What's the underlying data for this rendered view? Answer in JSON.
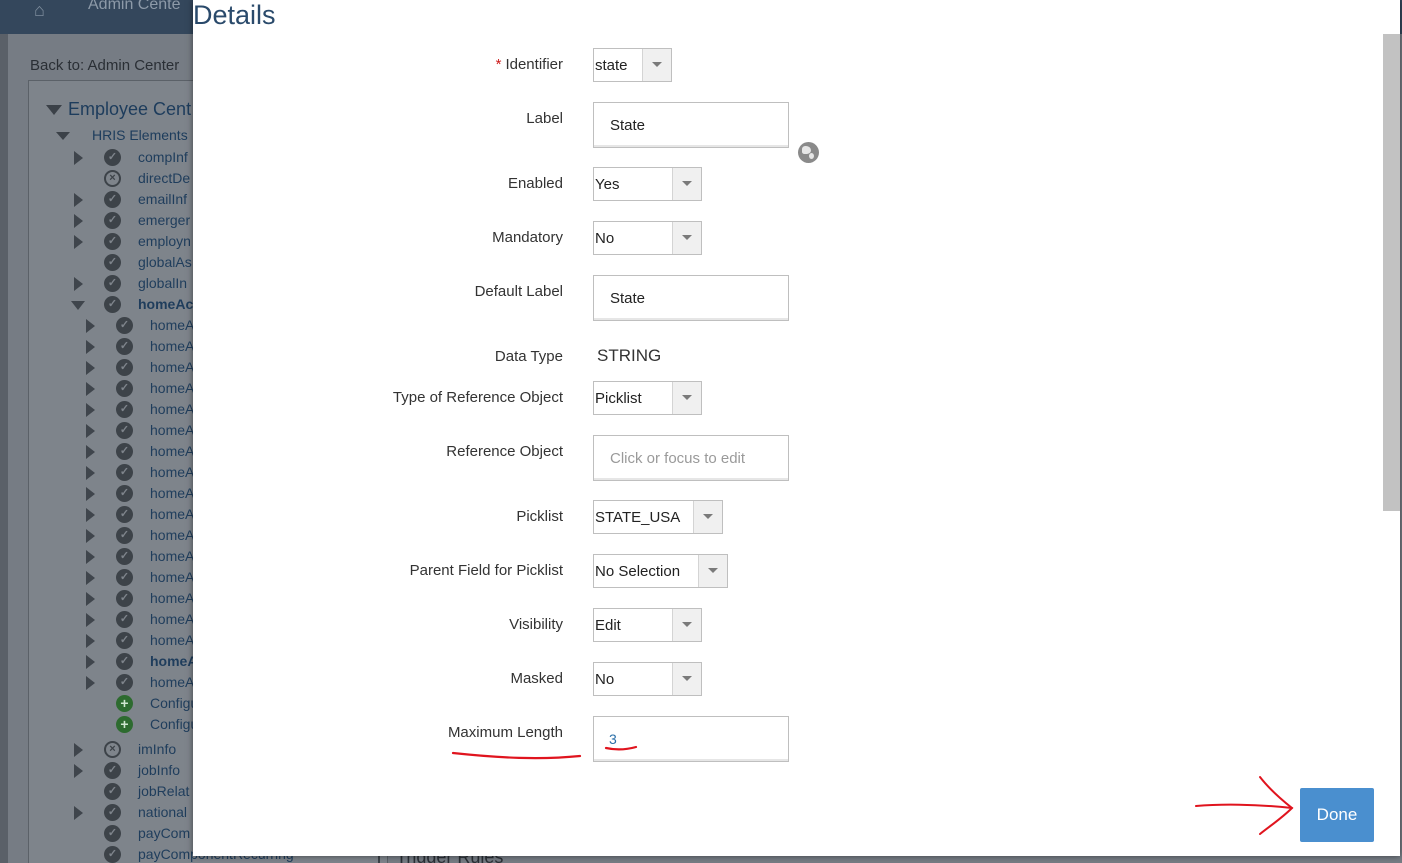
{
  "background": {
    "header_app": "Admin Cente",
    "back_link": "Back to: Admin Center",
    "tree_root": "Employee Cent",
    "tree_hris": "HRIS Elements",
    "tree_items": [
      {
        "label": "compInf",
        "icon": "ok",
        "arrow": "closed",
        "indent": 0
      },
      {
        "label": "directDe",
        "icon": "x",
        "arrow": "none",
        "indent": 0
      },
      {
        "label": "emailInf",
        "icon": "ok",
        "arrow": "closed",
        "indent": 0
      },
      {
        "label": "emerger",
        "icon": "ok",
        "arrow": "closed",
        "indent": 0
      },
      {
        "label": "employn",
        "icon": "ok",
        "arrow": "closed",
        "indent": 0
      },
      {
        "label": "globalAs",
        "icon": "ok",
        "arrow": "none",
        "indent": 0
      },
      {
        "label": "globalIn",
        "icon": "ok",
        "arrow": "closed",
        "indent": 0
      },
      {
        "label": "homeAc",
        "icon": "ok",
        "arrow": "open",
        "indent": 0,
        "bold": true
      },
      {
        "label": "homeAc",
        "icon": "ok",
        "arrow": "closed",
        "indent": 1
      },
      {
        "label": "homeAc",
        "icon": "ok",
        "arrow": "closed",
        "indent": 1
      },
      {
        "label": "homeAc",
        "icon": "ok",
        "arrow": "closed",
        "indent": 1
      },
      {
        "label": "homeAc",
        "icon": "ok",
        "arrow": "closed",
        "indent": 1
      },
      {
        "label": "homeAc",
        "icon": "ok",
        "arrow": "closed",
        "indent": 1
      },
      {
        "label": "homeAc",
        "icon": "ok",
        "arrow": "closed",
        "indent": 1
      },
      {
        "label": "homeAc",
        "icon": "ok",
        "arrow": "closed",
        "indent": 1
      },
      {
        "label": "homeAc",
        "icon": "ok",
        "arrow": "closed",
        "indent": 1
      },
      {
        "label": "homeAc",
        "icon": "ok",
        "arrow": "closed",
        "indent": 1
      },
      {
        "label": "homeAc",
        "icon": "ok",
        "arrow": "closed",
        "indent": 1
      },
      {
        "label": "homeAc",
        "icon": "ok",
        "arrow": "closed",
        "indent": 1
      },
      {
        "label": "homeAc",
        "icon": "ok",
        "arrow": "closed",
        "indent": 1
      },
      {
        "label": "homeAc",
        "icon": "ok",
        "arrow": "closed",
        "indent": 1
      },
      {
        "label": "homeAc",
        "icon": "ok",
        "arrow": "closed",
        "indent": 1
      },
      {
        "label": "homeAc",
        "icon": "ok",
        "arrow": "closed",
        "indent": 1
      },
      {
        "label": "homeAc",
        "icon": "ok",
        "arrow": "closed",
        "indent": 1
      },
      {
        "label": "homeA",
        "icon": "ok",
        "arrow": "closed",
        "indent": 1,
        "bold": true
      },
      {
        "label": "homeAc",
        "icon": "ok",
        "arrow": "closed",
        "indent": 1
      },
      {
        "label": "Configu",
        "icon": "plus",
        "arrow": "none",
        "indent": 1
      },
      {
        "label": "Configu",
        "icon": "plus",
        "arrow": "none",
        "indent": 1
      },
      {
        "label": "imInfo",
        "icon": "x",
        "arrow": "closed",
        "indent": 0
      },
      {
        "label": "jobInfo",
        "icon": "ok",
        "arrow": "closed",
        "indent": 0
      },
      {
        "label": "jobRelat",
        "icon": "ok",
        "arrow": "none",
        "indent": 0
      },
      {
        "label": "national",
        "icon": "ok",
        "arrow": "closed",
        "indent": 0
      },
      {
        "label": "payCom",
        "icon": "ok",
        "arrow": "none",
        "indent": 0
      },
      {
        "label": "payComponentRecurring",
        "icon": "ok",
        "arrow": "none",
        "indent": 0
      }
    ],
    "trigger_rules": "Trigger Rules"
  },
  "dialog": {
    "title": "Details",
    "identifier": {
      "label": "Identifier",
      "required_mark": "*",
      "value": "state"
    },
    "label_field": {
      "label": "Label",
      "value": "State"
    },
    "enabled": {
      "label": "Enabled",
      "value": "Yes"
    },
    "mandatory": {
      "label": "Mandatory",
      "value": "No"
    },
    "default_label": {
      "label": "Default Label",
      "value": "State"
    },
    "data_type": {
      "label": "Data Type",
      "value": "STRING"
    },
    "ref_type": {
      "label": "Type of Reference Object",
      "value": "Picklist"
    },
    "ref_object": {
      "label": "Reference Object",
      "placeholder": "Click or focus to edit"
    },
    "picklist": {
      "label": "Picklist",
      "value": "STATE_USA"
    },
    "parent_picklist": {
      "label": "Parent Field for Picklist",
      "value": "No Selection"
    },
    "visibility": {
      "label": "Visibility",
      "value": "Edit"
    },
    "masked": {
      "label": "Masked",
      "value": "No"
    },
    "max_length": {
      "label": "Maximum Length",
      "value": "3"
    },
    "done_label": "Done"
  },
  "colors": {
    "done_button": "#4a8fcf",
    "title": "#2a4a6b",
    "annotation": "#e0141e"
  },
  "icons": [
    "home-icon",
    "globe-icon",
    "chevron-down-icon",
    "check-circle-icon",
    "x-circle-icon",
    "plus-circle-icon"
  ]
}
